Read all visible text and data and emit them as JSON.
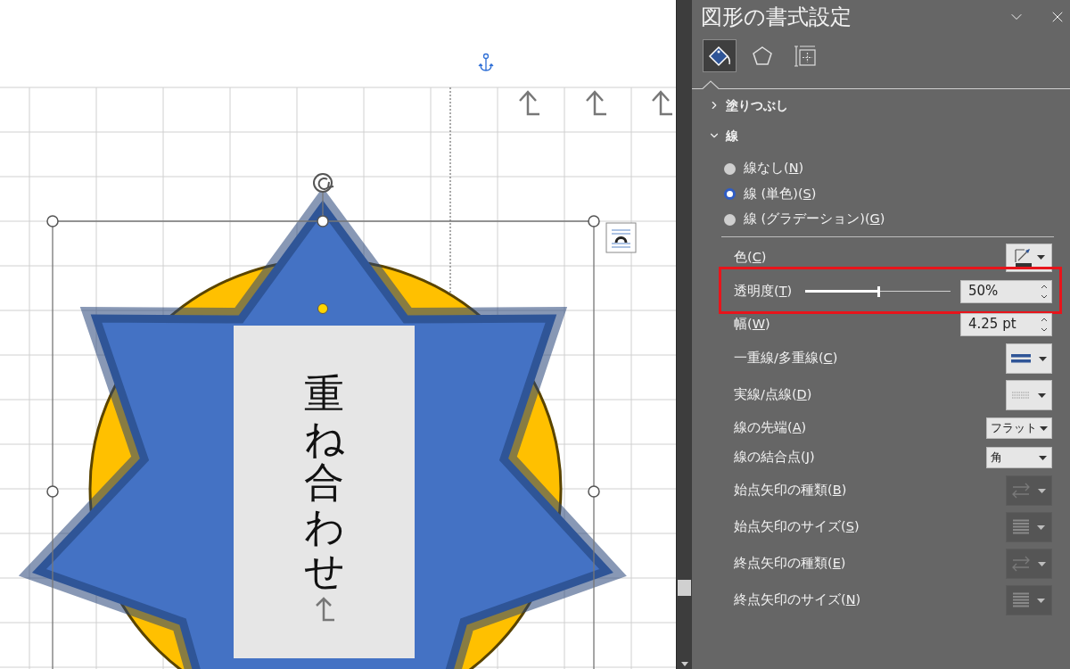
{
  "canvas": {
    "text_box": {
      "text": "重ね合わせ"
    }
  },
  "panel": {
    "title": "図形の書式設定",
    "tabs": [
      {
        "kind": "fill_line",
        "selected": true
      },
      {
        "kind": "effects",
        "selected": false
      },
      {
        "kind": "size",
        "selected": false
      }
    ],
    "sections": [
      {
        "title": "塗りつぶし",
        "expanded": false
      },
      {
        "title": "線",
        "expanded": true
      }
    ],
    "line_options": [
      {
        "label": "線なし(N)",
        "selected": false
      },
      {
        "label": "線 (単色)(S)",
        "selected": true
      },
      {
        "label": "線 (グラデーション)(G)",
        "selected": false
      }
    ],
    "properties": [
      {
        "label": "色(C)",
        "kind": "color_button",
        "disabled": false
      },
      {
        "label": "透明度(T)",
        "kind": "slider",
        "level": 0.5,
        "value": "50%",
        "highlighted": true
      },
      {
        "label": "幅(W)",
        "kind": "spin",
        "value": "4.25 pt"
      },
      {
        "label": "一重線/多重線(C)",
        "kind": "compound",
        "disabled": false
      },
      {
        "label": "実線/点線(D)",
        "kind": "dash",
        "disabled": false
      },
      {
        "label": "線の先端(A)",
        "kind": "dropdown",
        "value": "フラット"
      },
      {
        "label": "線の結合点(J)",
        "kind": "dropdown",
        "value": "角"
      },
      {
        "label": "始点矢印の種類(B)",
        "kind": "arrow_type",
        "disabled": true
      },
      {
        "label": "始点矢印のサイズ(S)",
        "kind": "arrow_size",
        "disabled": true
      },
      {
        "label": "終点矢印の種類(E)",
        "kind": "arrow_type",
        "disabled": true
      },
      {
        "label": "終点矢印のサイズ(N)",
        "kind": "arrow_size",
        "disabled": true
      }
    ]
  }
}
